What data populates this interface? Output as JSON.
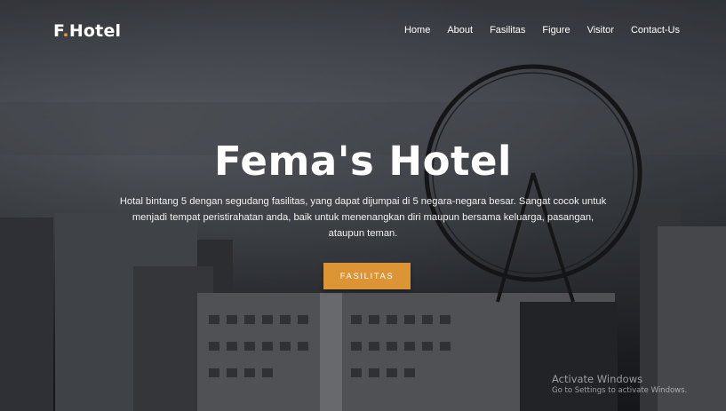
{
  "brand": {
    "text": "F",
    "dot": ".",
    "rest": "Hotel"
  },
  "nav": {
    "items": [
      {
        "label": "Home"
      },
      {
        "label": "About"
      },
      {
        "label": "Fasilitas"
      },
      {
        "label": "Figure"
      },
      {
        "label": "Visitor"
      },
      {
        "label": "Contact-Us"
      }
    ]
  },
  "hero": {
    "title": "Fema's Hotel",
    "description": "Hotal bintang 5 dengan segudang fasilitas, yang dapat dijumpai di 5 negara-negara besar. Sangat cocok untuk menjadi tempat peristirahatan anda, baik untuk menenangkan diri maupun bersama keluarga, pasangan, ataupun teman.",
    "cta_label": "FASILITAS"
  },
  "watermark": {
    "title": "Activate Windows",
    "subtitle": "Go to Settings to activate Windows."
  },
  "colors": {
    "accent": "#dd9435",
    "text": "#ffffff"
  }
}
